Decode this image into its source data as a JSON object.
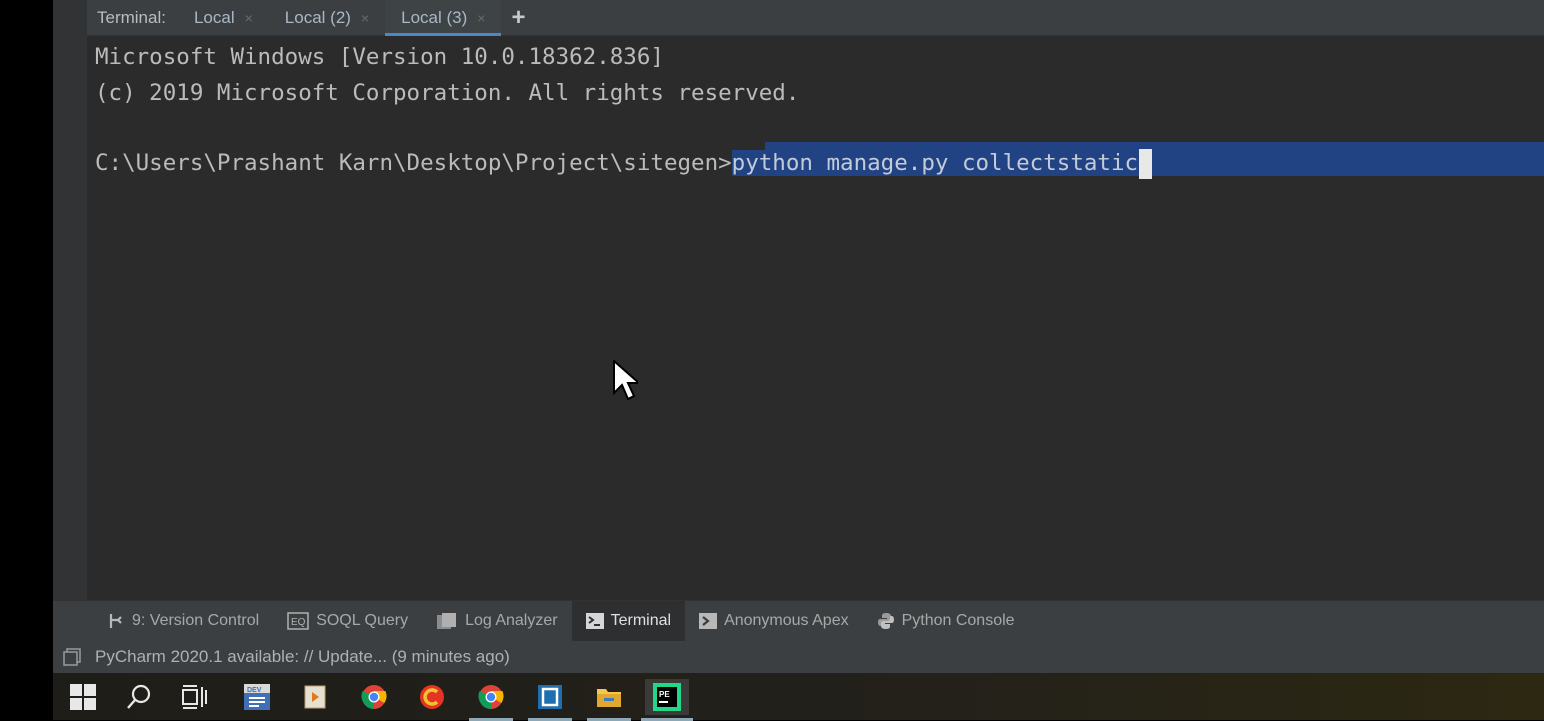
{
  "terminal": {
    "tabs_label": "Terminal:",
    "tabs": [
      {
        "label": "Local",
        "close": "×"
      },
      {
        "label": "Local (2)",
        "close": "×"
      },
      {
        "label": "Local (3)",
        "close": "×"
      }
    ],
    "add_tab": "+",
    "lines": {
      "line1": "Microsoft Windows [Version 10.0.18362.836]",
      "line2": "(c) 2019 Microsoft Corporation. All rights reserved.",
      "prompt": "C:\\Users\\Prashant Karn\\Desktop\\Project\\sitegen>",
      "command": "python manage.py collectstatic"
    }
  },
  "tool_windows": [
    {
      "label": "9: Version Control",
      "icon": "version-control-icon"
    },
    {
      "label": "SOQL Query",
      "icon": "soql-icon"
    },
    {
      "label": "Log Analyzer",
      "icon": "log-analyzer-icon"
    },
    {
      "label": "Terminal",
      "icon": "terminal-icon"
    },
    {
      "label": "Anonymous Apex",
      "icon": "apex-icon"
    },
    {
      "label": "Python Console",
      "icon": "python-icon"
    }
  ],
  "status": {
    "message": "PyCharm 2020.1 available: // Update... (9 minutes ago)"
  },
  "colors": {
    "selection": "#214283",
    "accent": "#4a88c7",
    "background": "#2b2b2b"
  },
  "taskbar": {
    "items": [
      "windows-start-icon",
      "search-icon",
      "task-view-icon",
      "devcpp-icon",
      "media-player-icon",
      "chrome-icon",
      "ccleaner-icon",
      "chrome-icon",
      "app-icon",
      "file-explorer-icon",
      "pycharm-icon"
    ]
  }
}
